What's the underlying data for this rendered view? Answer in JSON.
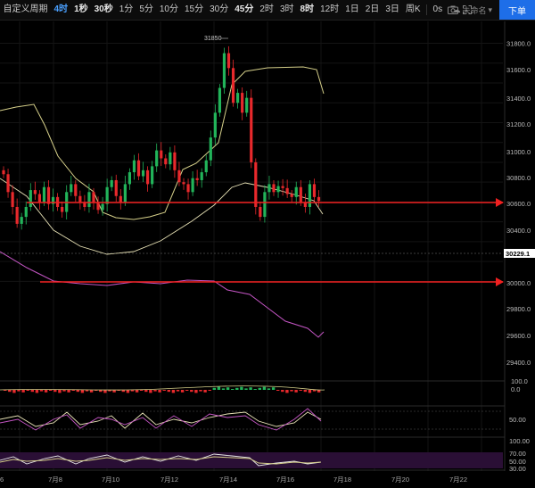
{
  "toolbar": {
    "items": [
      {
        "label": "自定义周期",
        "state": "normal"
      },
      {
        "label": "4时",
        "state": "active"
      },
      {
        "label": "1秒",
        "state": "hl"
      },
      {
        "label": "30秒",
        "state": "hl"
      },
      {
        "label": "1分",
        "state": "normal"
      },
      {
        "label": "5分",
        "state": "normal"
      },
      {
        "label": "10分",
        "state": "normal"
      },
      {
        "label": "15分",
        "state": "normal"
      },
      {
        "label": "30分",
        "state": "normal"
      },
      {
        "label": "45分",
        "state": "hl"
      },
      {
        "label": "2时",
        "state": "normal"
      },
      {
        "label": "3时",
        "state": "normal"
      },
      {
        "label": "8时",
        "state": "hl"
      },
      {
        "label": "12时",
        "state": "normal"
      },
      {
        "label": "1日",
        "state": "normal"
      },
      {
        "label": "2日",
        "state": "normal"
      },
      {
        "label": "3日",
        "state": "normal"
      },
      {
        "label": "周K",
        "state": "normal"
      }
    ],
    "seconds_label": "0s",
    "cloud_label": "未命名",
    "order_button": "下单"
  },
  "chart": {
    "price_ticks": [
      "31800.0",
      "31600.0",
      "31400.0",
      "31200.0",
      "31000.0",
      "30800.0",
      "30600.0",
      "30400.0",
      "30000.0",
      "29800.0",
      "29600.0",
      "29400.0"
    ],
    "current_price": "30229.1",
    "high_marker": "31850",
    "macd_ticks": [
      "100.0",
      "0.0"
    ],
    "osc1_ticks": [
      "50.00"
    ],
    "osc2_ticks": [
      "100.00",
      "70.00",
      "50.00",
      "30.00"
    ],
    "date_labels": [
      "6",
      "7月8",
      "7月10",
      "7月12",
      "7月14",
      "7月16",
      "7月18",
      "7月20",
      "7月22"
    ],
    "colors": {
      "up": "#22b45a",
      "down": "#e8292c",
      "band": "#d6d08a",
      "lower_band": "#c455c4",
      "line": "#f02020"
    }
  }
}
